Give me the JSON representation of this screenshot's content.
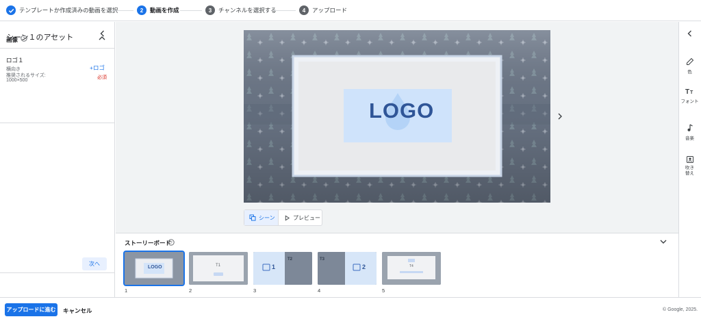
{
  "stepper": {
    "steps": [
      {
        "number": "✓",
        "label": "テンプレートか作成済みの動画を選択",
        "state": "done"
      },
      {
        "number": "2",
        "label": "動画を作成",
        "state": "active"
      },
      {
        "number": "3",
        "label": "チャンネルを選択する",
        "state": "todo"
      },
      {
        "number": "4",
        "label": "アップロード",
        "state": "todo"
      }
    ]
  },
  "left_panel": {
    "title": "シーン１のアセット",
    "section_title": "画像",
    "asset": {
      "name": "ロゴ１",
      "orientation": "横向き",
      "recommended_label": "推奨されるサイズ:",
      "recommended_size": "1000×500",
      "add_label": "+ロゴ",
      "required_label": "必須"
    },
    "next_label": "次へ"
  },
  "preview": {
    "logo_text": "LOGO",
    "toggle": {
      "scene_label": "シーン",
      "preview_label": "プレビュー"
    }
  },
  "storyboard": {
    "title": "ストーリーボード",
    "thumbs": [
      {
        "number": "1",
        "text": "LOGO"
      },
      {
        "number": "2",
        "text": "T1"
      },
      {
        "number": "3",
        "text": "1",
        "tag": "T2"
      },
      {
        "number": "4",
        "text": "2",
        "tag": "T3"
      },
      {
        "number": "5",
        "text": "T4"
      }
    ]
  },
  "right_rail": {
    "tools": [
      {
        "label": "色",
        "icon": "eyedropper-icon"
      },
      {
        "label": "フォント",
        "icon": "font-icon"
      },
      {
        "label": "音楽",
        "icon": "music-note-icon"
      },
      {
        "label": "吹き替え",
        "icon": "voiceover-icon"
      }
    ]
  },
  "footer": {
    "upload_label": "アップロードに進む",
    "cancel_label": "キャンセル",
    "copyright": "© Google, 2025."
  },
  "colors": {
    "accent": "#1a73e8",
    "step_inactive": "#5f6368",
    "required": "#d93025"
  }
}
